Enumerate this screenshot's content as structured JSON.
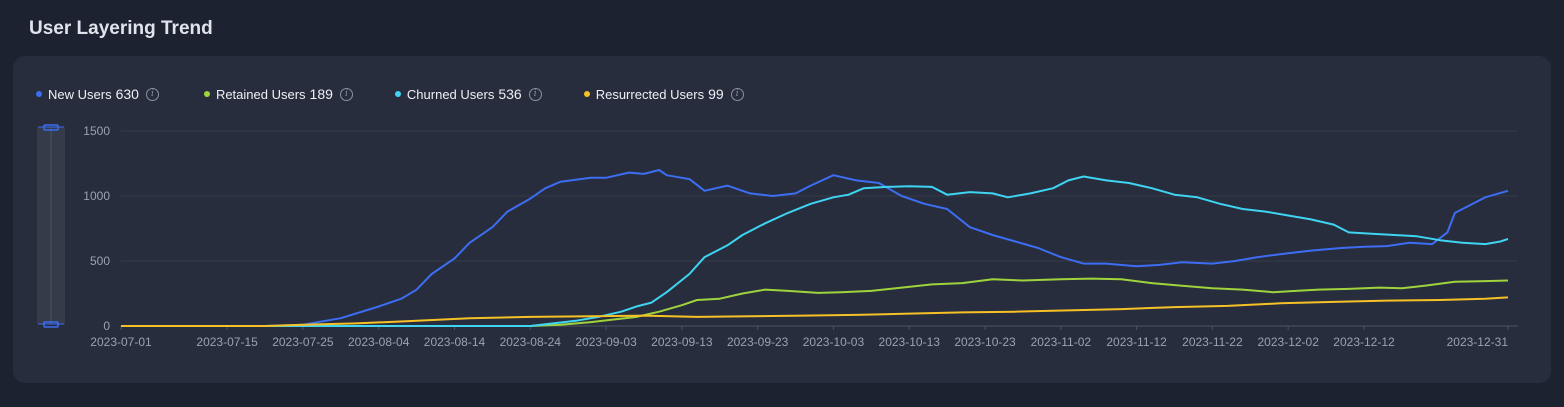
{
  "page": {
    "title": "User Layering Trend"
  },
  "legend": [
    {
      "label": "New Users",
      "value": "630",
      "color": "#3d6df2"
    },
    {
      "label": "Retained Users",
      "value": "189",
      "color": "#9fd33d"
    },
    {
      "label": "Churned Users",
      "value": "536",
      "color": "#3ed4f2"
    },
    {
      "label": "Resurrected Users",
      "value": "99",
      "color": "#f5c125"
    }
  ],
  "chart_data": {
    "type": "line",
    "title": "User Layering Trend",
    "x_start": "2023-07-01",
    "x_end": "2023-12-31",
    "x_tick_labels": [
      "2023-07-01",
      "2023-07-15",
      "2023-07-25",
      "2023-08-04",
      "2023-08-14",
      "2023-08-24",
      "2023-09-03",
      "2023-09-13",
      "2023-09-23",
      "2023-10-03",
      "2023-10-13",
      "2023-10-23",
      "2023-11-02",
      "2023-11-12",
      "2023-11-22",
      "2023-12-02",
      "2023-12-12",
      "2023-12-31"
    ],
    "y_ticks": [
      0,
      500,
      1000,
      1500
    ],
    "ylim": [
      0,
      1500
    ],
    "grid": true,
    "legend_position": "top-left",
    "series": [
      {
        "name": "New Users",
        "color": "#3d6df2",
        "points": [
          [
            "2023-07-01",
            0
          ],
          [
            "2023-07-20",
            0
          ],
          [
            "2023-07-25",
            10
          ],
          [
            "2023-07-30",
            60
          ],
          [
            "2023-08-04",
            150
          ],
          [
            "2023-08-07",
            210
          ],
          [
            "2023-08-09",
            280
          ],
          [
            "2023-08-11",
            400
          ],
          [
            "2023-08-14",
            520
          ],
          [
            "2023-08-16",
            640
          ],
          [
            "2023-08-19",
            760
          ],
          [
            "2023-08-21",
            880
          ],
          [
            "2023-08-24",
            980
          ],
          [
            "2023-08-26",
            1060
          ],
          [
            "2023-08-28",
            1110
          ],
          [
            "2023-09-01",
            1140
          ],
          [
            "2023-09-03",
            1140
          ],
          [
            "2023-09-06",
            1180
          ],
          [
            "2023-09-08",
            1170
          ],
          [
            "2023-09-10",
            1200
          ],
          [
            "2023-09-11",
            1160
          ],
          [
            "2023-09-14",
            1130
          ],
          [
            "2023-09-16",
            1040
          ],
          [
            "2023-09-19",
            1080
          ],
          [
            "2023-09-22",
            1020
          ],
          [
            "2023-09-25",
            1000
          ],
          [
            "2023-09-28",
            1020
          ],
          [
            "2023-09-30",
            1080
          ],
          [
            "2023-10-03",
            1160
          ],
          [
            "2023-10-06",
            1120
          ],
          [
            "2023-10-09",
            1100
          ],
          [
            "2023-10-12",
            1000
          ],
          [
            "2023-10-15",
            940
          ],
          [
            "2023-10-18",
            900
          ],
          [
            "2023-10-21",
            760
          ],
          [
            "2023-10-24",
            700
          ],
          [
            "2023-10-27",
            650
          ],
          [
            "2023-10-30",
            600
          ],
          [
            "2023-11-02",
            530
          ],
          [
            "2023-11-05",
            480
          ],
          [
            "2023-11-08",
            480
          ],
          [
            "2023-11-12",
            460
          ],
          [
            "2023-11-15",
            470
          ],
          [
            "2023-11-18",
            490
          ],
          [
            "2023-11-22",
            480
          ],
          [
            "2023-11-25",
            500
          ],
          [
            "2023-11-28",
            530
          ],
          [
            "2023-12-02",
            560
          ],
          [
            "2023-12-05",
            580
          ],
          [
            "2023-12-09",
            600
          ],
          [
            "2023-12-12",
            610
          ],
          [
            "2023-12-15",
            615
          ],
          [
            "2023-12-18",
            640
          ],
          [
            "2023-12-21",
            630
          ],
          [
            "2023-12-23",
            720
          ],
          [
            "2023-12-24",
            870
          ],
          [
            "2023-12-26",
            930
          ],
          [
            "2023-12-28",
            990
          ],
          [
            "2023-12-31",
            1040
          ]
        ]
      },
      {
        "name": "Retained Users",
        "color": "#9fd33d",
        "points": [
          [
            "2023-07-01",
            0
          ],
          [
            "2023-08-24",
            0
          ],
          [
            "2023-08-28",
            10
          ],
          [
            "2023-09-01",
            30
          ],
          [
            "2023-09-04",
            50
          ],
          [
            "2023-09-07",
            70
          ],
          [
            "2023-09-10",
            110
          ],
          [
            "2023-09-13",
            160
          ],
          [
            "2023-09-15",
            200
          ],
          [
            "2023-09-18",
            210
          ],
          [
            "2023-09-21",
            250
          ],
          [
            "2023-09-24",
            280
          ],
          [
            "2023-09-27",
            270
          ],
          [
            "2023-10-01",
            255
          ],
          [
            "2023-10-04",
            260
          ],
          [
            "2023-10-08",
            270
          ],
          [
            "2023-10-12",
            295
          ],
          [
            "2023-10-16",
            320
          ],
          [
            "2023-10-20",
            330
          ],
          [
            "2023-10-24",
            360
          ],
          [
            "2023-10-28",
            350
          ],
          [
            "2023-11-02",
            360
          ],
          [
            "2023-11-06",
            365
          ],
          [
            "2023-11-10",
            360
          ],
          [
            "2023-11-14",
            330
          ],
          [
            "2023-11-18",
            310
          ],
          [
            "2023-11-22",
            290
          ],
          [
            "2023-11-26",
            280
          ],
          [
            "2023-11-30",
            260
          ],
          [
            "2023-12-03",
            270
          ],
          [
            "2023-12-06",
            280
          ],
          [
            "2023-12-10",
            285
          ],
          [
            "2023-12-14",
            295
          ],
          [
            "2023-12-17",
            290
          ],
          [
            "2023-12-20",
            310
          ],
          [
            "2023-12-24",
            340
          ],
          [
            "2023-12-28",
            345
          ],
          [
            "2023-12-31",
            350
          ]
        ]
      },
      {
        "name": "Churned Users",
        "color": "#3ed4f2",
        "points": [
          [
            "2023-07-01",
            0
          ],
          [
            "2023-08-24",
            0
          ],
          [
            "2023-08-27",
            20
          ],
          [
            "2023-08-30",
            40
          ],
          [
            "2023-09-02",
            70
          ],
          [
            "2023-09-05",
            110
          ],
          [
            "2023-09-07",
            150
          ],
          [
            "2023-09-09",
            180
          ],
          [
            "2023-09-11",
            260
          ],
          [
            "2023-09-14",
            400
          ],
          [
            "2023-09-16",
            530
          ],
          [
            "2023-09-19",
            620
          ],
          [
            "2023-09-21",
            700
          ],
          [
            "2023-09-24",
            790
          ],
          [
            "2023-09-27",
            870
          ],
          [
            "2023-09-30",
            940
          ],
          [
            "2023-10-03",
            990
          ],
          [
            "2023-10-05",
            1010
          ],
          [
            "2023-10-07",
            1060
          ],
          [
            "2023-10-10",
            1070
          ],
          [
            "2023-10-13",
            1075
          ],
          [
            "2023-10-16",
            1070
          ],
          [
            "2023-10-18",
            1010
          ],
          [
            "2023-10-21",
            1030
          ],
          [
            "2023-10-24",
            1020
          ],
          [
            "2023-10-26",
            990
          ],
          [
            "2023-10-29",
            1020
          ],
          [
            "2023-11-01",
            1060
          ],
          [
            "2023-11-03",
            1120
          ],
          [
            "2023-11-05",
            1150
          ],
          [
            "2023-11-08",
            1120
          ],
          [
            "2023-11-11",
            1100
          ],
          [
            "2023-11-14",
            1060
          ],
          [
            "2023-11-17",
            1010
          ],
          [
            "2023-11-20",
            990
          ],
          [
            "2023-11-23",
            940
          ],
          [
            "2023-11-26",
            900
          ],
          [
            "2023-11-29",
            880
          ],
          [
            "2023-12-02",
            850
          ],
          [
            "2023-12-05",
            820
          ],
          [
            "2023-12-08",
            780
          ],
          [
            "2023-12-10",
            720
          ],
          [
            "2023-12-13",
            710
          ],
          [
            "2023-12-16",
            700
          ],
          [
            "2023-12-19",
            690
          ],
          [
            "2023-12-22",
            660
          ],
          [
            "2023-12-25",
            640
          ],
          [
            "2023-12-28",
            630
          ],
          [
            "2023-12-30",
            650
          ],
          [
            "2023-12-31",
            670
          ]
        ]
      },
      {
        "name": "Resurrected Users",
        "color": "#f5c125",
        "points": [
          [
            "2023-07-01",
            0
          ],
          [
            "2023-07-20",
            0
          ],
          [
            "2023-07-25",
            10
          ],
          [
            "2023-08-01",
            20
          ],
          [
            "2023-08-09",
            40
          ],
          [
            "2023-08-16",
            60
          ],
          [
            "2023-08-24",
            70
          ],
          [
            "2023-09-01",
            75
          ],
          [
            "2023-09-08",
            80
          ],
          [
            "2023-09-15",
            70
          ],
          [
            "2023-09-22",
            75
          ],
          [
            "2023-09-29",
            80
          ],
          [
            "2023-10-06",
            85
          ],
          [
            "2023-10-13",
            95
          ],
          [
            "2023-10-20",
            105
          ],
          [
            "2023-10-27",
            110
          ],
          [
            "2023-11-03",
            120
          ],
          [
            "2023-11-10",
            130
          ],
          [
            "2023-11-17",
            145
          ],
          [
            "2023-11-24",
            155
          ],
          [
            "2023-12-01",
            175
          ],
          [
            "2023-12-08",
            185
          ],
          [
            "2023-12-15",
            195
          ],
          [
            "2023-12-22",
            200
          ],
          [
            "2023-12-28",
            210
          ],
          [
            "2023-12-31",
            220
          ]
        ]
      }
    ]
  }
}
